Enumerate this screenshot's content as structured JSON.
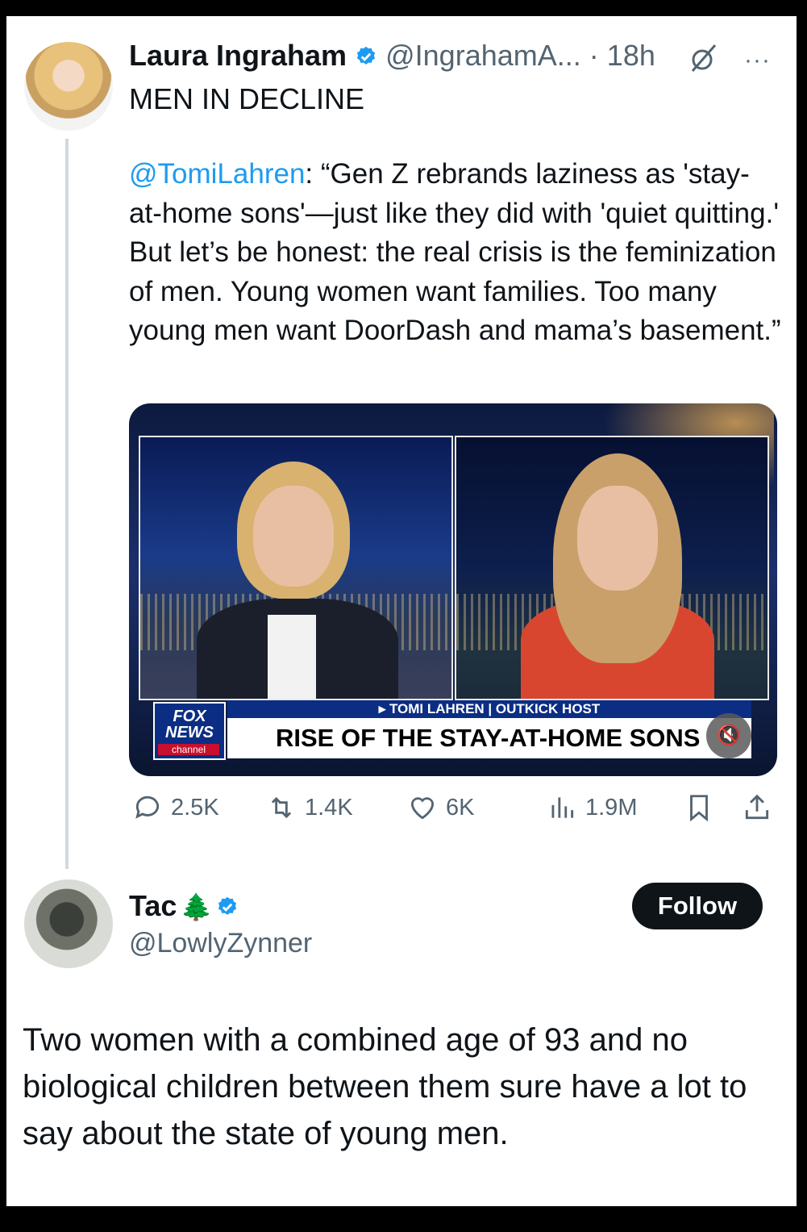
{
  "tweet": {
    "author_name": "Laura Ingraham",
    "author_handle": "@IngrahamA...",
    "dot": "·",
    "time": "18h",
    "more": "···",
    "headline": "MEN IN DECLINE",
    "quote_mention": "@TomiLahren",
    "quote_body": ": “Gen Z rebrands laziness as 'stay-at-home sons'—just like they did with 'quiet quitting.' But let’s be honest: the real crisis is the feminization of men. Young women want families. Too many young men want DoorDash and mama’s basement.”",
    "media": {
      "logo_line1": "FOX",
      "logo_line2": "NEWS",
      "logo_channel": "channel",
      "name_strip": "▸ TOMI LAHREN | OUTKICK HOST",
      "headline_strip": "RISE OF THE STAY-AT-HOME SONS",
      "mute_icon": "🔇"
    },
    "actions": {
      "replies": "2.5K",
      "reposts": "1.4K",
      "likes": "6K",
      "views": "1.9M"
    },
    "colors": {
      "accent": "#1d9bf0",
      "text": "#0f1419",
      "muted": "#536471"
    }
  },
  "reply": {
    "author_name": "Tac",
    "emoji": "🌲",
    "author_handle": "@LowlyZynner",
    "follow_label": "Follow",
    "text": "Two women with a combined age of 93 and no biological children between them sure have a lot to say about the state of young men."
  }
}
